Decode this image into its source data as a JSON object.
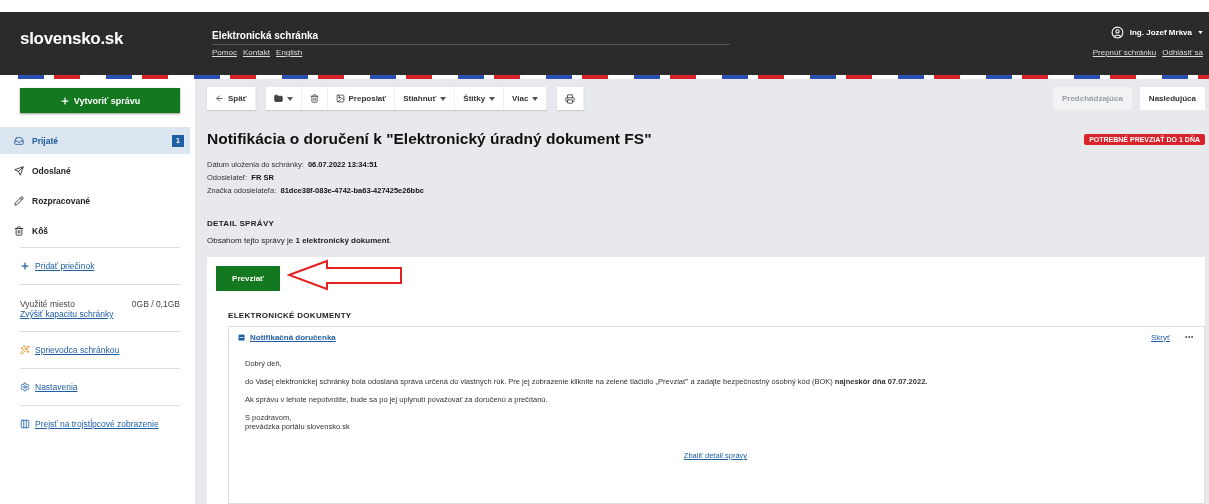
{
  "header": {
    "logo": "slovensko.sk",
    "title": "Elektronická schránka",
    "links": [
      "Pomoc",
      "Kontakt",
      "English"
    ],
    "user": "Ing. Jozef Mrkva",
    "user_links": [
      "Prepnúť schránku",
      "Odhlásiť sa"
    ]
  },
  "sidebar": {
    "create_button": "Vytvoriť správu",
    "items": [
      {
        "kind": "inbox",
        "label": "Prijaté",
        "selected": true,
        "count": "1"
      },
      {
        "kind": "sent",
        "label": "Odoslané",
        "selected": false
      },
      {
        "kind": "draft",
        "label": "Rozpracované",
        "selected": false
      },
      {
        "kind": "trash",
        "label": "Kôš",
        "selected": false
      }
    ],
    "add_folder": "Pridať priečinok",
    "storage": {
      "label": "Využité miesto",
      "value": "0GB / 0,1GB",
      "link": "Zvýšiť kapacitu schránky"
    },
    "links": [
      {
        "kind": "wizard",
        "label": "Sprievodca schránkou"
      },
      {
        "kind": "settings",
        "label": "Nastavenia"
      },
      {
        "kind": "columns",
        "label": "Prejsť na trojstĺpcové zobrazenie"
      }
    ]
  },
  "toolbar": {
    "back": "Späť",
    "group": [
      {
        "kind": "folder"
      },
      {
        "kind": "trash"
      },
      {
        "kind": "forward",
        "label": "Preposlať"
      },
      {
        "kind": "menu",
        "label": "Stiahnuť"
      },
      {
        "kind": "menu",
        "label": "Štítky"
      },
      {
        "kind": "menu",
        "label": "Viac"
      }
    ],
    "pager": [
      {
        "label": "Predchádzajúca",
        "disabled": true
      },
      {
        "label": "Nasledujúca",
        "disabled": false
      }
    ]
  },
  "message": {
    "title": "Notifikácia o doručení k \"Elektronický úradný dokument FS\"",
    "badge": "POTREBNÉ PREVZIAŤ DO 1 DŇA",
    "meta": [
      {
        "label": "Dátum uloženia do schránky:",
        "value": "06.07.2022 13:34:51"
      },
      {
        "label": "Odosielateľ:",
        "value": "FR SR"
      },
      {
        "label": "Značka odosielateľa:",
        "value": "81dce38f-083e-4742-ba63-427425e26bbc"
      }
    ],
    "detail_heading": "DETAIL SPRÁVY",
    "detail_text": "Obsahom tejto správy je **1 elektronický dokument**.",
    "accept_button": "Prevziať",
    "documents_heading": "ELEKTRONICKÉ DOKUMENTY",
    "document": {
      "title": "Notifikačná doručenka",
      "expanded": true,
      "hide": "Skryť",
      "paragraphs": [
        "Dobrý deň,",
        "do Vašej elektronickej schránky bola odoslaná správa určená do vlastných rúk. Pre jej zobrazenie kliknite na zelené tlačidlo „Prevziať\" a zadajte bezpečnostný osobný kód (BOK) **najneskôr dňa 07.07.2022.**",
        "Ak správu v lehote nepotvrdíte, bude sa po jej uplynutí považovať za doručenú a prečítanú."
      ],
      "signature": [
        "S pozdravom,",
        "prevádzka portálu slovensko.sk"
      ]
    },
    "collapse": "Zbaliť detail správy"
  }
}
